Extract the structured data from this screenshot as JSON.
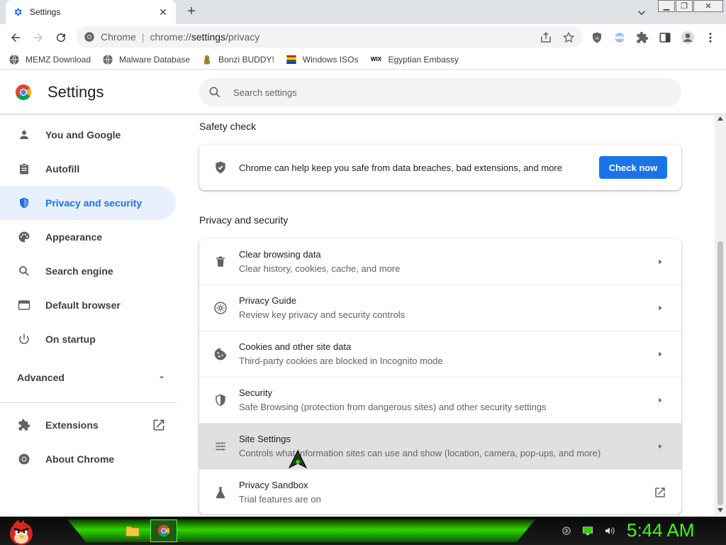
{
  "browser": {
    "tab_title": "Settings",
    "omnibox_host": "Chrome",
    "omnibox_url_prefix": "chrome://",
    "omnibox_url_path": "settings",
    "omnibox_url_suffix": "/privacy"
  },
  "bookmarks": [
    {
      "label": "MEMZ Download",
      "icon": "globe-icon"
    },
    {
      "label": "Malware Database",
      "icon": "globe-icon"
    },
    {
      "label": "Bonzi BUDDY!",
      "icon": "bonzi-icon"
    },
    {
      "label": "Windows ISOs",
      "icon": "windows-flag-icon"
    },
    {
      "label": "Egyptian Embassy",
      "icon": "wix-icon",
      "icon_text": "WIX"
    }
  ],
  "header": {
    "title": "Settings",
    "search_placeholder": "Search settings"
  },
  "sidebar": {
    "items": [
      {
        "label": "You and Google",
        "icon": "person-icon"
      },
      {
        "label": "Autofill",
        "icon": "clipboard-icon"
      },
      {
        "label": "Privacy and security",
        "icon": "shield-icon",
        "active": true
      },
      {
        "label": "Appearance",
        "icon": "palette-icon"
      },
      {
        "label": "Search engine",
        "icon": "search-icon"
      },
      {
        "label": "Default browser",
        "icon": "browser-icon"
      },
      {
        "label": "On startup",
        "icon": "power-icon"
      }
    ],
    "advanced_label": "Advanced",
    "bottom_items": [
      {
        "label": "Extensions",
        "icon": "puzzle-icon"
      },
      {
        "label": "About Chrome",
        "icon": "chrome-icon"
      }
    ]
  },
  "safety_check": {
    "heading": "Safety check",
    "text": "Chrome can help keep you safe from data breaches, bad extensions, and more",
    "button": "Check now"
  },
  "privacy": {
    "heading": "Privacy and security",
    "rows": [
      {
        "title": "Clear browsing data",
        "subtitle": "Clear history, cookies, cache, and more",
        "icon": "trash-icon"
      },
      {
        "title": "Privacy Guide",
        "subtitle": "Review key privacy and security controls",
        "icon": "compass-icon"
      },
      {
        "title": "Cookies and other site data",
        "subtitle": "Third-party cookies are blocked in Incognito mode",
        "icon": "cookie-icon"
      },
      {
        "title": "Security",
        "subtitle": "Safe Browsing (protection from dangerous sites) and other security settings",
        "icon": "shield-icon"
      },
      {
        "title": "Site Settings",
        "subtitle": "Controls what information sites can use and show (location, camera, pop-ups, and more)",
        "icon": "tune-icon",
        "hovered": true
      },
      {
        "title": "Privacy Sandbox",
        "subtitle": "Trial features are on",
        "icon": "flask-icon",
        "external": true
      }
    ]
  },
  "taskbar": {
    "clock": "5:44 AM"
  },
  "colors": {
    "accent": "#1a73e8",
    "active_nav_bg": "#e8f0fe",
    "clock": "#39ff14"
  }
}
